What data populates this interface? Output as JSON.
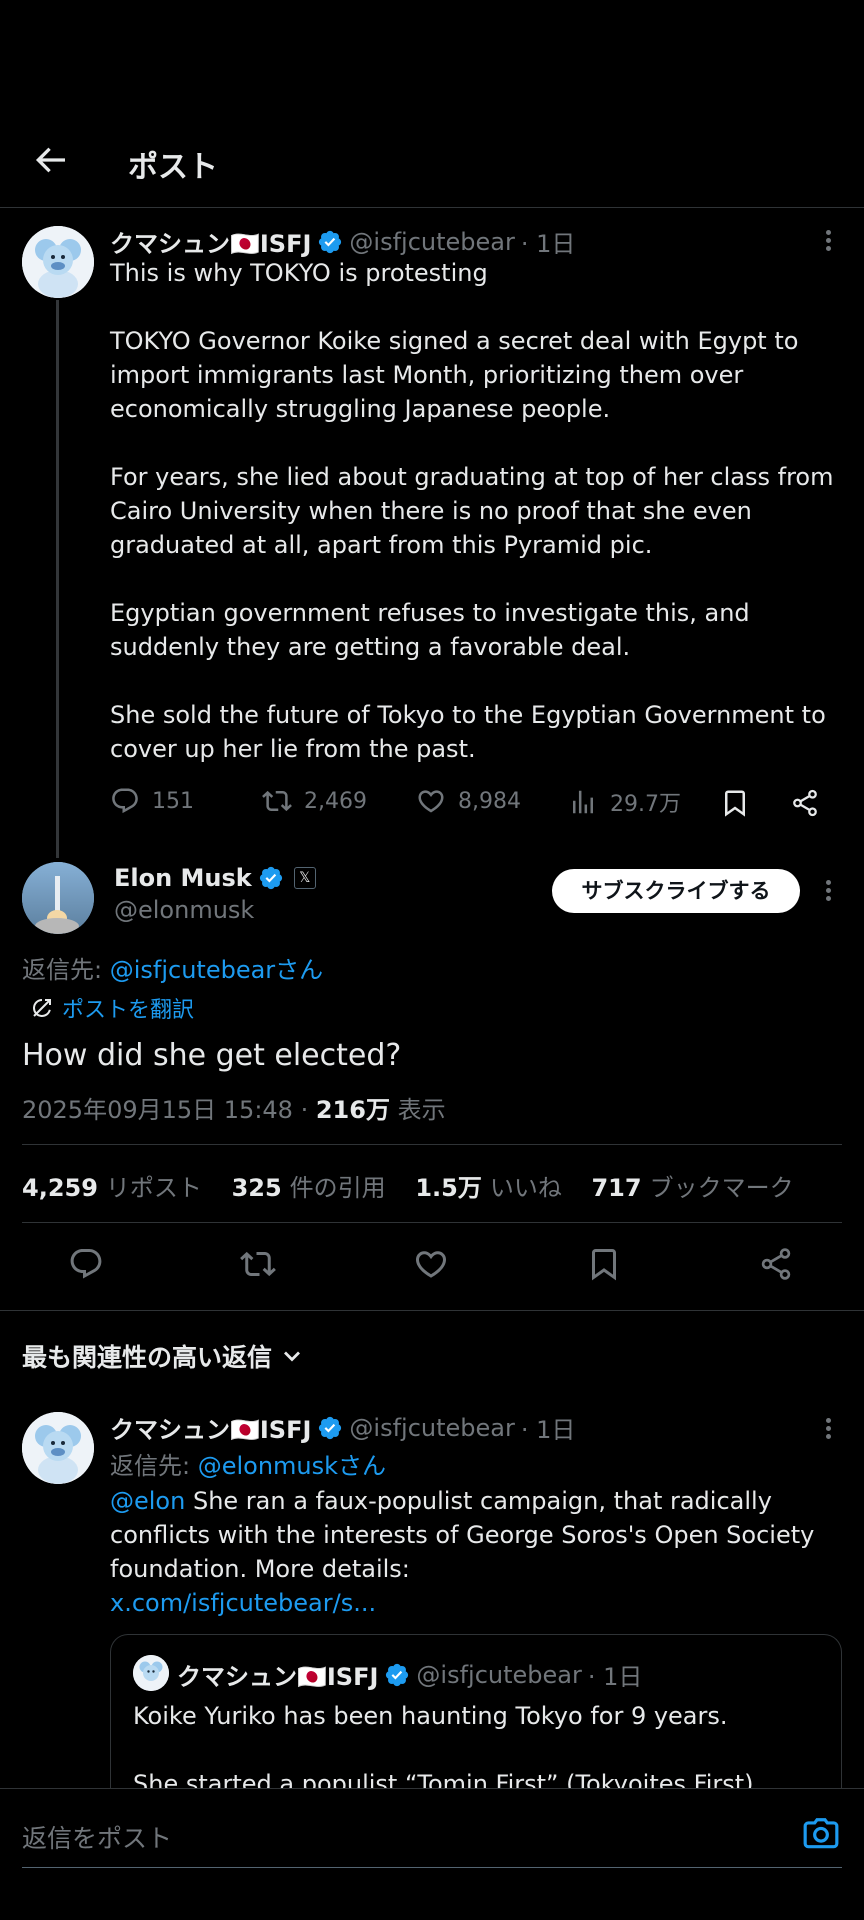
{
  "header": {
    "title": "ポスト"
  },
  "parent_post": {
    "name": "クマシュン🇯🇵ISFJ",
    "handle": "@isfjcutebear",
    "time": "· 1日",
    "paragraphs": [
      "This is why TOKYO is protesting",
      "TOKYO Governor Koike signed a secret deal with Egypt to import immigrants last Month, prioritizing them over economically struggling Japanese people.",
      "For years, she lied about graduating at top of her class from Cairo University when there is no proof that she even graduated at all, apart from this Pyramid pic.",
      "Egyptian government refuses to investigate this, and suddenly they are getting a favorable deal.",
      "She sold the future of Tokyo to the Egyptian Government to cover up her lie from the past."
    ],
    "actions": {
      "replies": "151",
      "reposts": "2,469",
      "likes": "8,984",
      "views": "29.7万"
    }
  },
  "main_post": {
    "name": "Elon Musk",
    "handle": "@elonmusk",
    "subscribe_label": "サブスクライブする",
    "reply_to_prefix": "返信先: ",
    "reply_to_handle": "@isfjcutebearさん",
    "translate_label": "ポストを翻訳",
    "text": "How did she get elected?",
    "timestamp": "2025年09月15日 15:48 · ",
    "views_count": "216万",
    "views_label": " 表示",
    "stats": [
      {
        "count": "4,259",
        "label": "リポスト"
      },
      {
        "count": "325",
        "label": "件の引用"
      },
      {
        "count": "1.5万",
        "label": "いいね"
      },
      {
        "count": "717",
        "label": "ブックマーク"
      }
    ]
  },
  "replies_sort": {
    "label": "最も関連性の高い返信"
  },
  "reply": {
    "name": "クマシュン🇯🇵ISFJ",
    "handle": "@isfjcutebear",
    "time": "· 1日",
    "reply_to_prefix": "返信先: ",
    "reply_to_handle": "@elonmuskさん",
    "mention": "@elon",
    "text": " She ran a faux-populist campaign, that radically conflicts with the interests of George Soros's Open Society foundation. More details:",
    "link": "x.com/isfjcutebear/s...",
    "quote": {
      "name": "クマシュン🇯🇵ISFJ",
      "handle": "@isfjcutebear",
      "time": "· 1日",
      "line1": "Koike Yuriko has been haunting Tokyo for 9 years.",
      "line2": "She started a populist “Tomin First” (Tokyoites First)"
    }
  },
  "composer": {
    "placeholder": "返信をポスト"
  }
}
